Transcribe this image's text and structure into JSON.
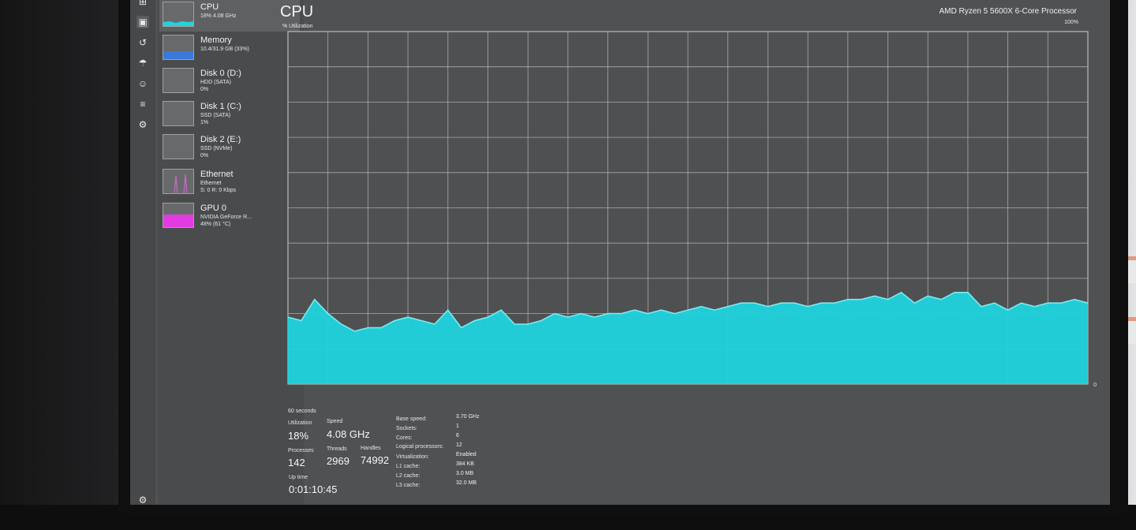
{
  "sidebar": {
    "devices": [
      {
        "title": "CPU",
        "sub": [
          "18% 4.08 GHz"
        ],
        "kind": "cpu"
      },
      {
        "title": "Memory",
        "sub": [
          "10.4/31.9 GB (33%)"
        ],
        "kind": "memory"
      },
      {
        "title": "Disk 0 (D:)",
        "sub": [
          "HDD (SATA)",
          "0%"
        ],
        "kind": "disk"
      },
      {
        "title": "Disk 1 (C:)",
        "sub": [
          "SSD (SATA)",
          "1%"
        ],
        "kind": "disk"
      },
      {
        "title": "Disk 2 (E:)",
        "sub": [
          "SSD (NVMe)",
          "0%"
        ],
        "kind": "disk"
      },
      {
        "title": "Ethernet",
        "sub": [
          "Ethernet",
          "S: 0 R: 0 Kbps"
        ],
        "kind": "ethernet"
      },
      {
        "title": "GPU 0",
        "sub": [
          "NVIDIA GeForce R...",
          "48% (61 °C)"
        ],
        "kind": "gpu"
      }
    ],
    "rail_icons": [
      "performance-icon",
      "app-history-icon",
      "startup-icon",
      "users-icon",
      "details-icon",
      "services-icon",
      "settings-icon"
    ]
  },
  "cpu": {
    "title": "CPU",
    "processor": "AMD Ryzen 5 5600X 6-Core Processor",
    "y_axis_label": "% Utilization",
    "y_max_label": "100%",
    "x_axis_label": "60 seconds",
    "x_min_label": "0",
    "stats": {
      "utilization_label": "Utilization",
      "utilization": "18%",
      "speed_label": "Speed",
      "speed": "4.08 GHz",
      "processes_label": "Processes",
      "processes": "142",
      "threads_label": "Threads",
      "threads": "2969",
      "handles_label": "Handles",
      "handles": "74992",
      "uptime_label": "Up time",
      "uptime": "0:01:10:45"
    },
    "specs": [
      {
        "label": "Base speed:",
        "value": "3.70 GHz"
      },
      {
        "label": "Sockets:",
        "value": "1"
      },
      {
        "label": "Cores:",
        "value": "6"
      },
      {
        "label": "Logical processors:",
        "value": "12"
      },
      {
        "label": "Virtualization:",
        "value": "Enabled"
      },
      {
        "label": "L1 cache:",
        "value": "384 KB"
      },
      {
        "label": "L2 cache:",
        "value": "3.0 MB"
      },
      {
        "label": "L3 cache:",
        "value": "32.0 MB"
      }
    ]
  },
  "colors": {
    "cpu_fill": "#1fd3de",
    "cpu_line": "#7fe9ef",
    "memory": "#3b78d8",
    "gpu": "#e23ce0",
    "ethernet": "#c86bc9"
  },
  "chart_data": {
    "type": "area",
    "title": "CPU",
    "ylabel": "% Utilization",
    "xlabel": "60 seconds",
    "ylim": [
      0,
      100
    ],
    "x": [
      60,
      59,
      58,
      57,
      56,
      55,
      54,
      53,
      52,
      51,
      50,
      49,
      48,
      47,
      46,
      45,
      44,
      43,
      42,
      41,
      40,
      39,
      38,
      37,
      36,
      35,
      34,
      33,
      32,
      31,
      30,
      29,
      28,
      27,
      26,
      25,
      24,
      23,
      22,
      21,
      20,
      19,
      18,
      17,
      16,
      15,
      14,
      13,
      12,
      11,
      10,
      9,
      8,
      7,
      6,
      5,
      4,
      3,
      2,
      1,
      0
    ],
    "series": [
      {
        "values": [
          19,
          18,
          24,
          20,
          17,
          15,
          16,
          16,
          18,
          19,
          18,
          17,
          21,
          16,
          18,
          19,
          21,
          17,
          17,
          18,
          20,
          19,
          20,
          19,
          20,
          20,
          21,
          20,
          21,
          20,
          21,
          22,
          21,
          22,
          23,
          23,
          22,
          23,
          23,
          22,
          23,
          23,
          24,
          24,
          25,
          24,
          26,
          23,
          25,
          24,
          26,
          26,
          22,
          23,
          21,
          23,
          22,
          23,
          23,
          24,
          23
        ]
      }
    ],
    "grid": true
  }
}
